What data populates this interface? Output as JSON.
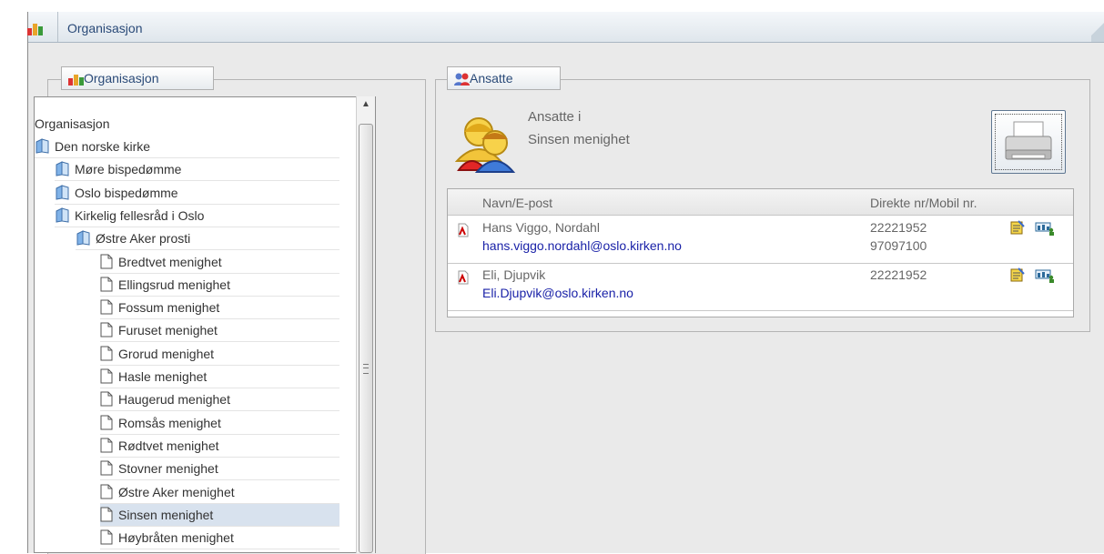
{
  "window": {
    "title": "Organisasjon"
  },
  "org_panel": {
    "legend": "Organisasjon"
  },
  "tree": {
    "root": "Organisasjon",
    "items": [
      {
        "label": "Den norske kirke",
        "type": "folder",
        "level": 0
      },
      {
        "label": "Møre bispedømme",
        "type": "folder",
        "level": 1
      },
      {
        "label": "Oslo bispedømme",
        "type": "folder",
        "level": 1
      },
      {
        "label": "Kirkelig fellesråd i Oslo",
        "type": "folder",
        "level": 2
      },
      {
        "label": "Østre Aker prosti",
        "type": "folder",
        "level": 3
      },
      {
        "label": "Bredtvet menighet",
        "type": "page",
        "level": 4
      },
      {
        "label": "Ellingsrud menighet",
        "type": "page",
        "level": 4
      },
      {
        "label": "Fossum menighet",
        "type": "page",
        "level": 4
      },
      {
        "label": "Furuset menighet",
        "type": "page",
        "level": 4
      },
      {
        "label": "Grorud menighet",
        "type": "page",
        "level": 4
      },
      {
        "label": "Hasle menighet",
        "type": "page",
        "level": 4
      },
      {
        "label": "Haugerud menighet",
        "type": "page",
        "level": 4
      },
      {
        "label": "Romsås menighet",
        "type": "page",
        "level": 4
      },
      {
        "label": "Rødtvet menighet",
        "type": "page",
        "level": 4
      },
      {
        "label": "Stovner menighet",
        "type": "page",
        "level": 4
      },
      {
        "label": "Østre Aker menighet",
        "type": "page",
        "level": 4
      },
      {
        "label": "Sinsen menighet",
        "type": "page",
        "level": 4,
        "selected": true
      },
      {
        "label": "Høybråten menighet",
        "type": "page",
        "level": 4
      }
    ]
  },
  "employees_panel": {
    "legend": "Ansatte",
    "heading_line1": "Ansatte i",
    "heading_line2": "Sinsen menighet",
    "print_icon": "printer-icon"
  },
  "table": {
    "headers": {
      "name": "Navn/E-post",
      "phone": "Direkte nr/Mobil nr."
    },
    "rows": [
      {
        "name": "Hans Viggo, Nordahl",
        "email": "hans.viggo.nordahl@oslo.kirken.no",
        "phone": "22221952",
        "mobile": "97097100"
      },
      {
        "name": "Eli, Djupvik",
        "email": "Eli.Djupvik@oslo.kirken.no",
        "phone": "22221952",
        "mobile": ""
      }
    ]
  },
  "colors": {
    "accent": "#2a4a78",
    "link": "#1a22a8",
    "selected_row": "#d8e2ee"
  }
}
